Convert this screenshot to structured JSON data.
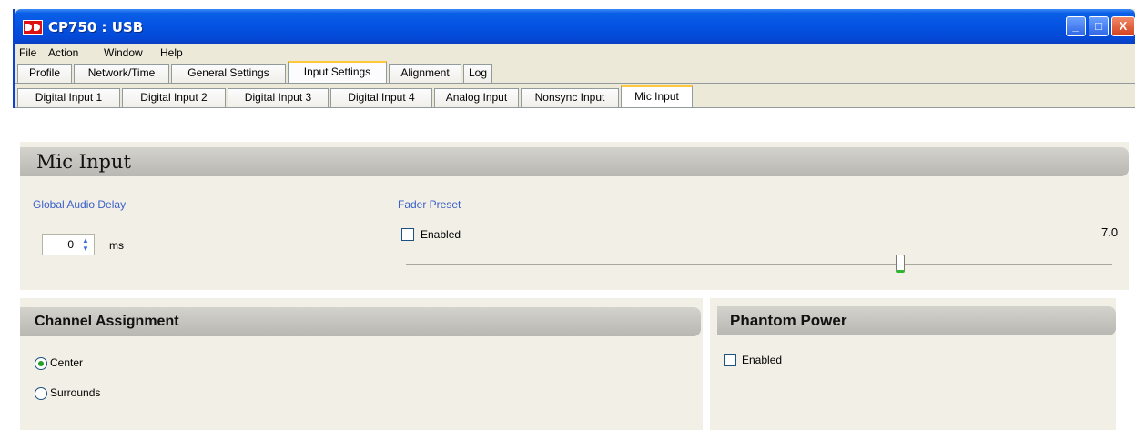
{
  "window": {
    "title": "CP750 : USB",
    "controls": {
      "minimize": "_",
      "maximize": "□",
      "close": "X"
    }
  },
  "menu": [
    "File",
    "Action",
    "Window",
    "Help"
  ],
  "tabs": [
    "Profile",
    "Network/Time",
    "General Settings",
    "Input Settings",
    "Alignment",
    "Log"
  ],
  "subtabs": [
    "Digital Input 1",
    "Digital Input 2",
    "Digital Input 3",
    "Digital Input 4",
    "Analog Input",
    "Nonsync Input",
    "Mic Input"
  ],
  "active_tab": "Input Settings",
  "active_subtab": "Mic Input",
  "mic_input": {
    "heading": "Mic Input",
    "global_audio_delay_label": "Global Audio Delay",
    "delay_value": "0",
    "delay_unit": "ms",
    "fader_preset_label": "Fader Preset",
    "fader_enabled_label": "Enabled",
    "fader_enabled": false,
    "fader_value": "7.0"
  },
  "channel_assignment": {
    "heading": "Channel Assignment",
    "options": [
      "Center",
      "Surrounds"
    ],
    "selected": "Center"
  },
  "phantom_power": {
    "heading": "Phantom Power",
    "enabled_label": "Enabled",
    "enabled": false
  },
  "icons": {
    "app": "dolby-icon",
    "spin_up": "▲",
    "spin_down": "▼"
  }
}
